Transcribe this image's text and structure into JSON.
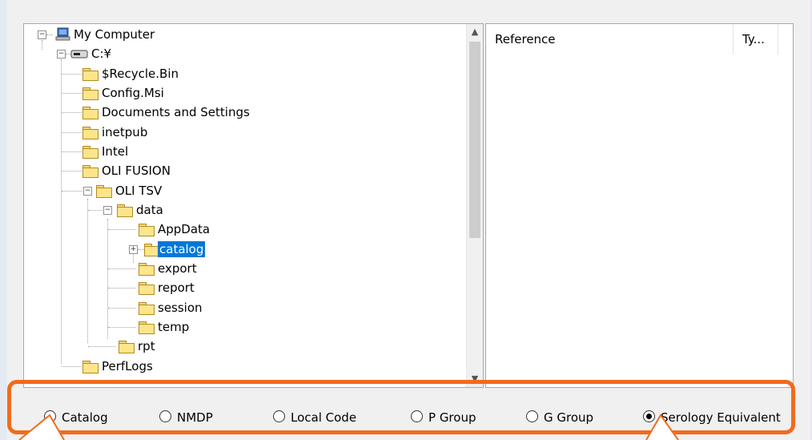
{
  "tree": {
    "root_label": "My Computer",
    "drive_label": "C:¥",
    "folders": {
      "recycle": "$Recycle.Bin",
      "config_msi": "Config.Msi",
      "documents": "Documents and Settings",
      "inetpub": "inetpub",
      "intel": "Intel",
      "oli_fusion": "OLI FUSION",
      "oli_tsv": "OLI TSV",
      "data": "data",
      "appdata": "AppData",
      "catalog": "catalog",
      "export": "export",
      "report": "report",
      "session": "session",
      "temp": "temp",
      "rpt": "rpt",
      "perflogs": "PerfLogs"
    },
    "selected": "catalog"
  },
  "list": {
    "columns": [
      "Reference",
      "Ty..."
    ]
  },
  "radio_options": {
    "catalog": "Catalog",
    "nmdp": "NMDP",
    "local_code": "Local Code",
    "p_group": "P Group",
    "g_group": "G Group",
    "serology": "Serology Equivalent"
  },
  "selected_option": "Serology Equivalent",
  "colors": {
    "highlight_border": "#f26b1d",
    "selection": "#0078d7",
    "folder": "#ffe58a"
  }
}
